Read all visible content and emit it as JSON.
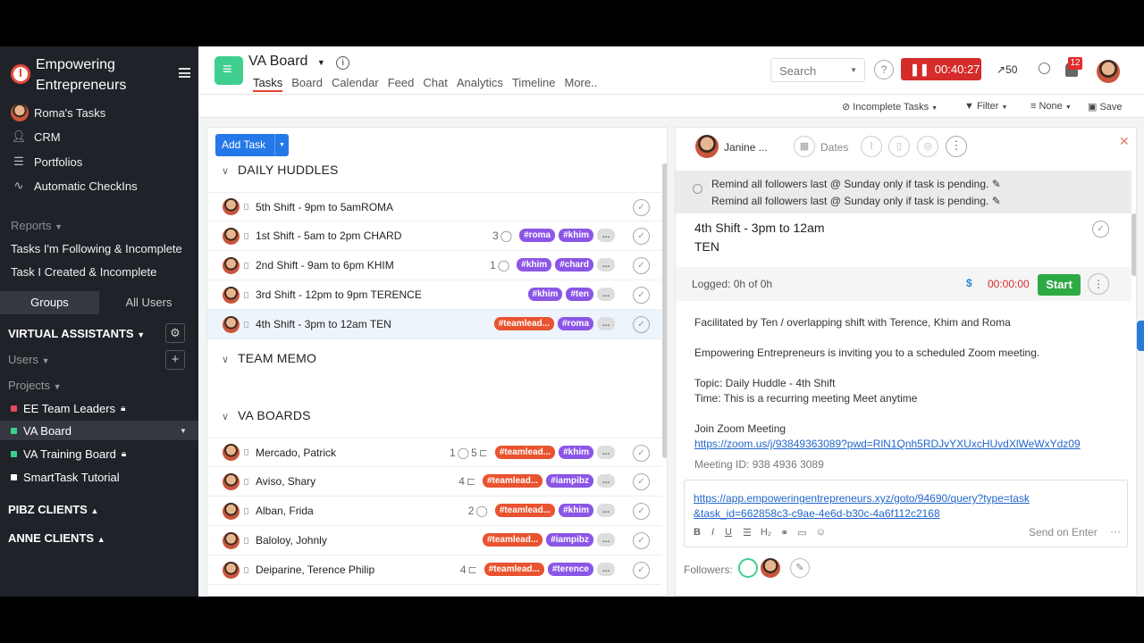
{
  "sidebar": {
    "brand": "Empowering Entrepreneurs",
    "nav": [
      "Roma's Tasks",
      "CRM",
      "Portfolios",
      "Automatic CheckIns"
    ],
    "reports_label": "Reports",
    "reports": [
      "Tasks I'm Following & Incomplete",
      "Task I Created & Incomplete"
    ],
    "groups_tab": "Groups",
    "users_tab": "All Users",
    "group_title": "VIRTUAL ASSISTANTS",
    "users_label": "Users",
    "projects_label": "Projects",
    "projects": [
      {
        "name": "EE Team Leaders",
        "color": "#e84a5f",
        "locked": true
      },
      {
        "name": "VA Board",
        "color": "#3ecf8e",
        "locked": false
      },
      {
        "name": "VA Training Board",
        "color": "#3ecf8e",
        "locked": true
      },
      {
        "name": "SmartTask Tutorial",
        "color": "#ffffff",
        "locked": false
      }
    ],
    "client_groups": [
      "PIBZ CLIENTS",
      "ANNE CLIENTS"
    ]
  },
  "topbar": {
    "board_title": "VA Board",
    "tabs": [
      "Tasks",
      "Board",
      "Calendar",
      "Feed",
      "Chat",
      "Analytics",
      "Timeline",
      "More.."
    ],
    "search_placeholder": "Search",
    "timer": "00:40:27",
    "trend": "50",
    "notif_count": "12"
  },
  "subbar": {
    "incomplete": "Incomplete Tasks",
    "filter": "Filter",
    "none": "None",
    "save": "Save"
  },
  "left": {
    "add_task": "Add Task",
    "sections": [
      {
        "title": "DAILY HUDDLES",
        "rows": [
          {
            "name": "5th Shift - 9pm to 5amROMA",
            "count": "",
            "tags": []
          },
          {
            "name": "1st Shift - 5am to 2pm CHARD",
            "count": "3",
            "tags": [
              "#roma",
              "#khim"
            ]
          },
          {
            "name": "2nd Shift - 9am to 6pm KHIM",
            "count": "1",
            "tags": [
              "#khim",
              "#chard"
            ]
          },
          {
            "name": "3rd Shift - 12pm to 9pm TERENCE",
            "count": "",
            "tags": [
              "#khim",
              "#ten"
            ]
          },
          {
            "name": "4th Shift - 3pm to 12am TEN",
            "count": "",
            "tags": [
              "#teamlead...",
              "#roma"
            ]
          }
        ]
      },
      {
        "title": "TEAM MEMO",
        "rows": []
      },
      {
        "title": "VA BOARDS",
        "rows": [
          {
            "name": "Mercado, Patrick",
            "count": "1",
            "count2": "5",
            "tags": [
              "#teamlead...",
              "#khim"
            ]
          },
          {
            "name": "Aviso, Shary",
            "count": "4",
            "tags": [
              "#teamlead...",
              "#iampibz"
            ]
          },
          {
            "name": "Alban, Frida",
            "count": "2",
            "tags": [
              "#teamlead...",
              "#khim"
            ]
          },
          {
            "name": "Baloloy, Johnly",
            "count": "",
            "tags": [
              "#teamlead...",
              "#iampibz"
            ]
          },
          {
            "name": "Deiparine, Terence Philip",
            "count": "4",
            "tags": [
              "#teamlead...",
              "#terence"
            ]
          }
        ]
      }
    ],
    "more_tag": "..."
  },
  "detail": {
    "assignee": "Janine ...",
    "dates": "Dates",
    "reminders": [
      "Remind all followers last @ Sunday only if task is pending.",
      "Remind all followers last @ Sunday only if task is pending."
    ],
    "title_line1": "4th Shift - 3pm to 12am",
    "title_line2": "TEN",
    "logged": "Logged: 0h of 0h",
    "currency": "$",
    "time": "00:00:00",
    "start": "Start",
    "desc": [
      "Facilitated by Ten / overlapping shift with Terence, Khim and Roma",
      "Empowering Entrepreneurs is inviting you to a scheduled Zoom meeting.",
      "Topic: Daily Huddle - 4th Shift",
      "Time: This is a recurring meeting Meet anytime",
      "Join Zoom Meeting"
    ],
    "zoom_link": "https://zoom.us/j/93849363089?pwd=RlN1Qnh5RDJvYXUxcHUvdXlWeWxYdz09",
    "cut_text": "Meeting ID: 938 4936 3089",
    "comment_link": "https://app.empoweringentrepreneurs.xyz/goto/94690/query?type=task&task_id=662858c3-c9ae-4e6d-b30c-4a6f112c2168",
    "send_hint": "Send on Enter",
    "followers": "Followers:"
  }
}
